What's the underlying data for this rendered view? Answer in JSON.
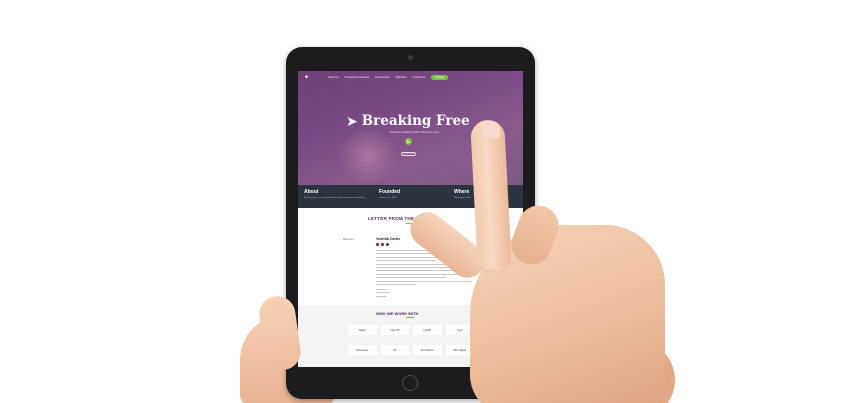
{
  "site": {
    "nav": {
      "items": [
        "About Us",
        "Programs & Services",
        "Get Involved",
        "Spenserz",
        "Contact Us"
      ],
      "donate_label": "Donate"
    },
    "hero": {
      "title": "Breaking Free",
      "tagline": "Survivors Helping Victims Become Free",
      "button_label": "Learn More"
    },
    "info_bar": [
      {
        "heading": "About",
        "body": "Breaking Free is a nonprofit dedicated to ending sex trafficking"
      },
      {
        "heading": "Founded",
        "body": "January 1st, 1996"
      },
      {
        "heading": "Where",
        "body": "Minneapolis, MN"
      }
    ],
    "letter": {
      "title": "LETTER FROM THE FOUNDER",
      "side_label": "Welcome !",
      "founder_name": "Vednita Carter"
    },
    "partners": {
      "title": "WHO WE WORK WITH",
      "logos": [
        "Safari",
        "Clay Hill",
        "Health",
        "Logo",
        "Minnesota",
        "AT",
        "Foundation",
        "NFF Rights"
      ]
    }
  },
  "colors": {
    "brand_purple": "#6e3f78",
    "accent_green": "#7cc242",
    "info_bar_bg": "#2c3440",
    "heading_purple": "#5b2b63"
  }
}
